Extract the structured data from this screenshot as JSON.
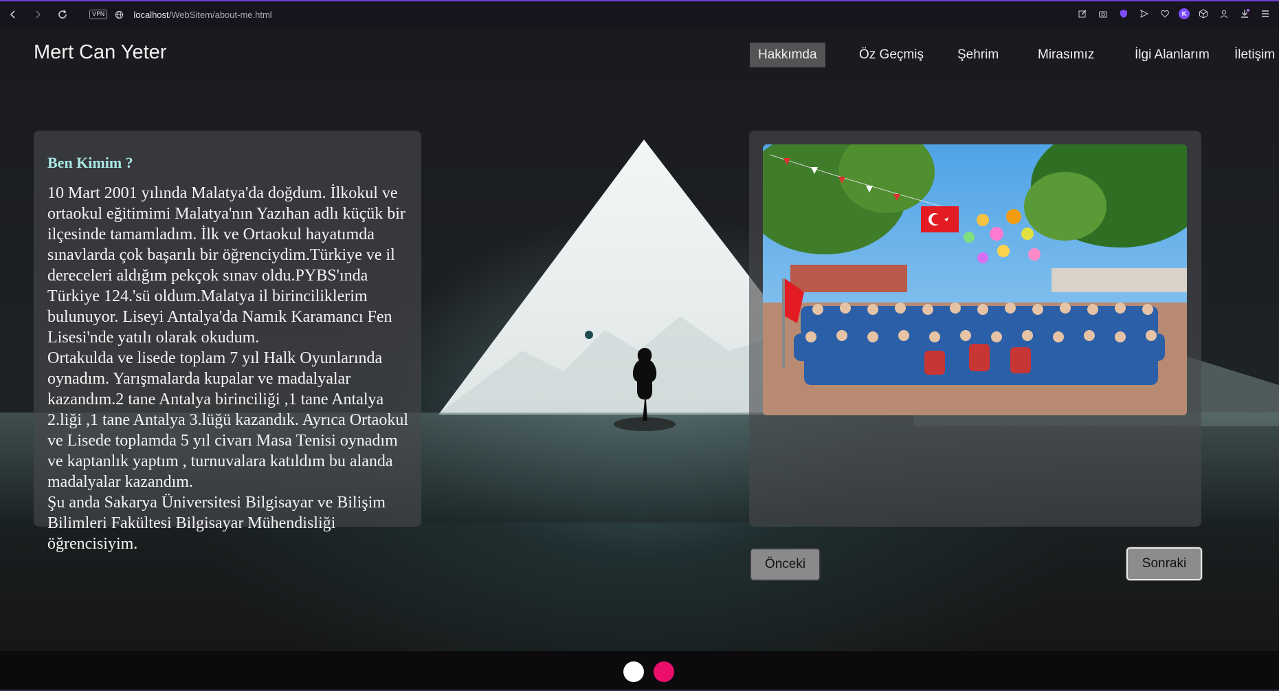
{
  "browser": {
    "vpn_label": "VPN",
    "url_host": "localhost",
    "url_path": "/WebSitem/about-me.html",
    "profile_initial": "K"
  },
  "site": {
    "brand": "Mert Can Yeter",
    "nav": [
      "Hakkımda",
      "Öz Geçmiş",
      "Şehrim",
      "Mirasımız",
      "İlgi Alanlarım",
      "İletişim"
    ],
    "active_nav": "Hakkımda"
  },
  "about": {
    "title": "Ben Kimim ?",
    "text": "10 Mart 2001 yılında Malatya'da doğdum. İlkokul ve ortaokul eğitimimi Malatya'nın Yazıhan adlı küçük bir ilçesinde tamamladım. İlk ve Ortaokul hayatımda sınavlarda çok başarılı bir öğrenciydim.Türkiye ve il dereceleri aldığım pekçok sınav oldu.PYBS'ında Türkiye 124.'sü oldum.Malatya il birinciliklerim bulunuyor. Liseyi Antalya'da Namık Karamancı Fen Lisesi'nde yatılı olarak okudum.\nOrtakulda ve lisede toplam 7 yıl Halk Oyunlarında oynadım. Yarışmalarda kupalar ve madalyalar kazandım.2 tane Antalya birinciliği ,1 tane Antalya 2.liği ,1 tane Antalya 3.lüğü kazandık. Ayrıca Ortaokul ve Lisede toplamda 5 yıl civarı Masa Tenisi oynadım ve kaptanlık yaptım , turnuvalara katıldım bu alanda madalyalar kazandım.\nŞu anda Sakarya Üniversitesi Bilgisayar ve Bilişim Bilimleri Fakültesi Bilgisayar Mühendisliği öğrencisiyim."
  },
  "slider": {
    "prev_label": "Önceki",
    "next_label": "Sonraki"
  },
  "colors": {
    "accent_title": "#a9e8e6",
    "dot_pink": "#ec0f6a",
    "browser_accent": "#6b3fd6"
  }
}
